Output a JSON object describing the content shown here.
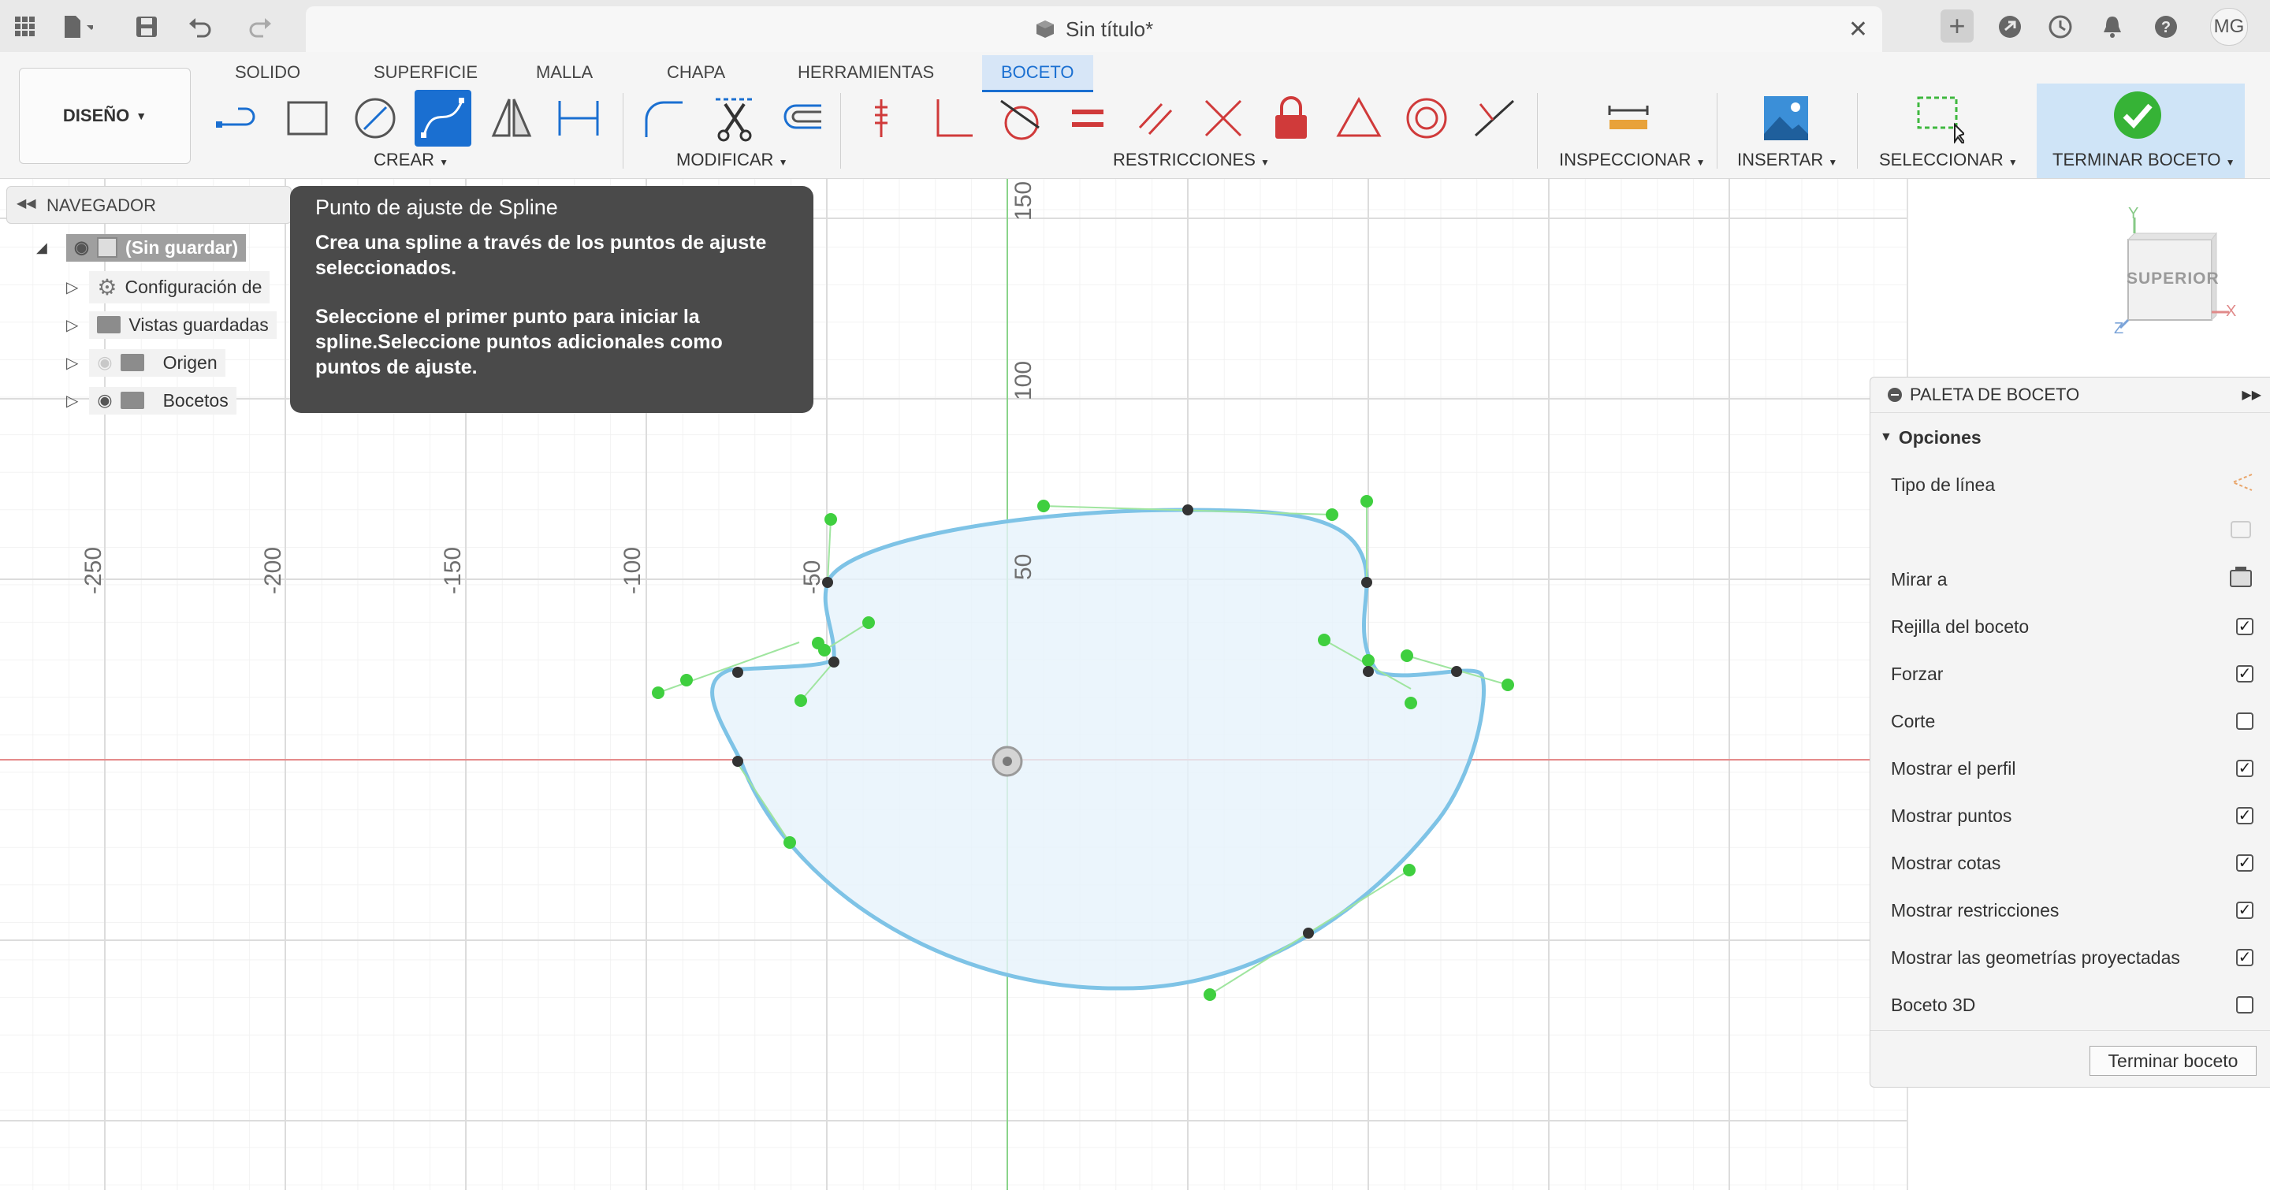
{
  "titlebar": {
    "document_title": "Sin título*",
    "user_initials": "MG",
    "icons": [
      "apps-grid-icon",
      "file-icon",
      "save-icon",
      "undo-icon",
      "redo-icon",
      "cube-icon",
      "close-icon",
      "plus-icon",
      "extensions-icon",
      "history-icon",
      "notifications-icon",
      "help-icon"
    ]
  },
  "toolbar": {
    "workspace": "DISEÑO",
    "tabs": [
      "SOLIDO",
      "SUPERFICIE",
      "MALLA",
      "CHAPA",
      "HERRAMIENTAS",
      "BOCETO"
    ],
    "active_tab": "BOCETO",
    "groups": {
      "crear": "CREAR",
      "modificar": "MODIFICAR",
      "restricciones": "RESTRICCIONES",
      "inspeccionar": "INSPECCIONAR",
      "insertar": "INSERTAR",
      "seleccionar": "SELECCIONAR",
      "terminar": "TERMINAR BOCETO"
    }
  },
  "navigator": {
    "title": "NAVEGADOR",
    "root": "(Sin guardar)",
    "items": [
      "Configuración de",
      "Vistas guardadas",
      "Origen",
      "Bocetos"
    ]
  },
  "tooltip": {
    "title": "Punto de ajuste de Spline",
    "description": "Crea una spline a través de los puntos de ajuste seleccionados.",
    "help": "Seleccione el primer punto para iniciar la spline.Seleccione puntos adicionales como puntos de ajuste."
  },
  "viewcube": {
    "face": "SUPERIOR",
    "x": "X",
    "y": "Y",
    "z": "Z"
  },
  "axis_labels": {
    "x": [
      "-250",
      "-200",
      "-150",
      "-100",
      "-50"
    ],
    "y": [
      "150",
      "100",
      "50"
    ]
  },
  "palette": {
    "title": "PALETA DE BOCETO",
    "section": "Opciones",
    "options": [
      {
        "label": "Tipo de línea",
        "type": "icon"
      },
      {
        "label": "",
        "type": "icon"
      },
      {
        "label": "Mirar a",
        "type": "icon"
      },
      {
        "label": "Rejilla del boceto",
        "type": "checkbox",
        "checked": true
      },
      {
        "label": "Forzar",
        "type": "checkbox",
        "checked": true
      },
      {
        "label": "Corte",
        "type": "checkbox",
        "checked": false
      },
      {
        "label": "Mostrar el perfil",
        "type": "checkbox",
        "checked": true
      },
      {
        "label": "Mostrar puntos",
        "type": "checkbox",
        "checked": true
      },
      {
        "label": "Mostrar cotas",
        "type": "checkbox",
        "checked": true
      },
      {
        "label": "Mostrar restricciones",
        "type": "checkbox",
        "checked": true
      },
      {
        "label": "Mostrar las geometrías proyectadas",
        "type": "checkbox",
        "checked": true
      },
      {
        "label": "Boceto 3D",
        "type": "checkbox",
        "checked": false
      }
    ],
    "finish_button": "Terminar boceto"
  },
  "colors": {
    "accent": "#1a6fd1",
    "spline": "#7ec3e6",
    "fit_point": "#39c939",
    "x_axis": "#e07070",
    "y_axis": "#7ad07a"
  }
}
